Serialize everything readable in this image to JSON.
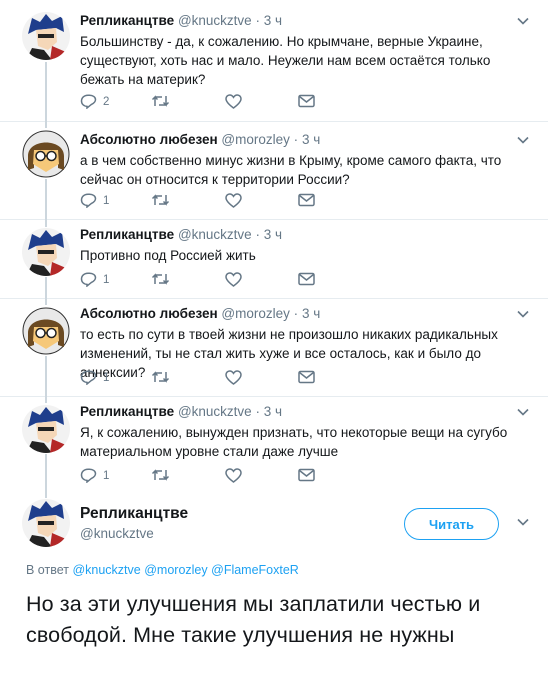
{
  "tweets": [
    {
      "display_name": "Репликанцтве",
      "handle": "@knuckztve",
      "time": "3 ч",
      "text": "Большинству - да, к сожалению. Но крымчане, верные Украине, существуют, хоть нас и мало. Неужели нам всем остаётся только бежать на материк?",
      "reply_count": "2",
      "avatar": "anime-boy"
    },
    {
      "display_name": "Абсолютно любезен",
      "handle": "@morozley",
      "time": "3 ч",
      "text": "а в чем собственно минус жизни в Крыму, кроме самого факта, что сейчас он относится к территории России?",
      "reply_count": "1",
      "avatar": "cartoon-girl"
    },
    {
      "display_name": "Репликанцтве",
      "handle": "@knuckztve",
      "time": "3 ч",
      "text": "Противно под Россией жить",
      "reply_count": "1",
      "avatar": "anime-boy"
    },
    {
      "display_name": "Абсолютно любезен",
      "handle": "@morozley",
      "time": "3 ч",
      "text": "то есть по сути в твоей жизни не произошло никаких радикальных изменений, ты не стал жить хуже и все осталось, как и было до аннексии?",
      "reply_count": "1",
      "avatar": "cartoon-girl"
    },
    {
      "display_name": "Репликанцтве",
      "handle": "@knuckztve",
      "time": "3 ч",
      "text": "Я, к сожалению, вынужден признать, что некоторые вещи на сугубо материальном уровне стали даже лучше",
      "reply_count": "1",
      "avatar": "anime-boy"
    }
  ],
  "main_tweet": {
    "display_name": "Репликанцтве",
    "handle": "@knuckztve",
    "follow_label": "Читать",
    "reply_to_label": "В ответ",
    "mentions": [
      "@knuckztve",
      "@morozley",
      "@FlameFoxteR"
    ],
    "text": "Но за эти улучшения мы заплатили честью и свободой. Мне такие улучшения не нужны"
  },
  "icons": [
    "reply-icon",
    "retweet-icon",
    "like-icon",
    "message-icon",
    "chevron-down-icon"
  ],
  "colors": {
    "accent": "#1da1f2",
    "secondary_text": "#657786",
    "divider": "#e6ecf0"
  }
}
